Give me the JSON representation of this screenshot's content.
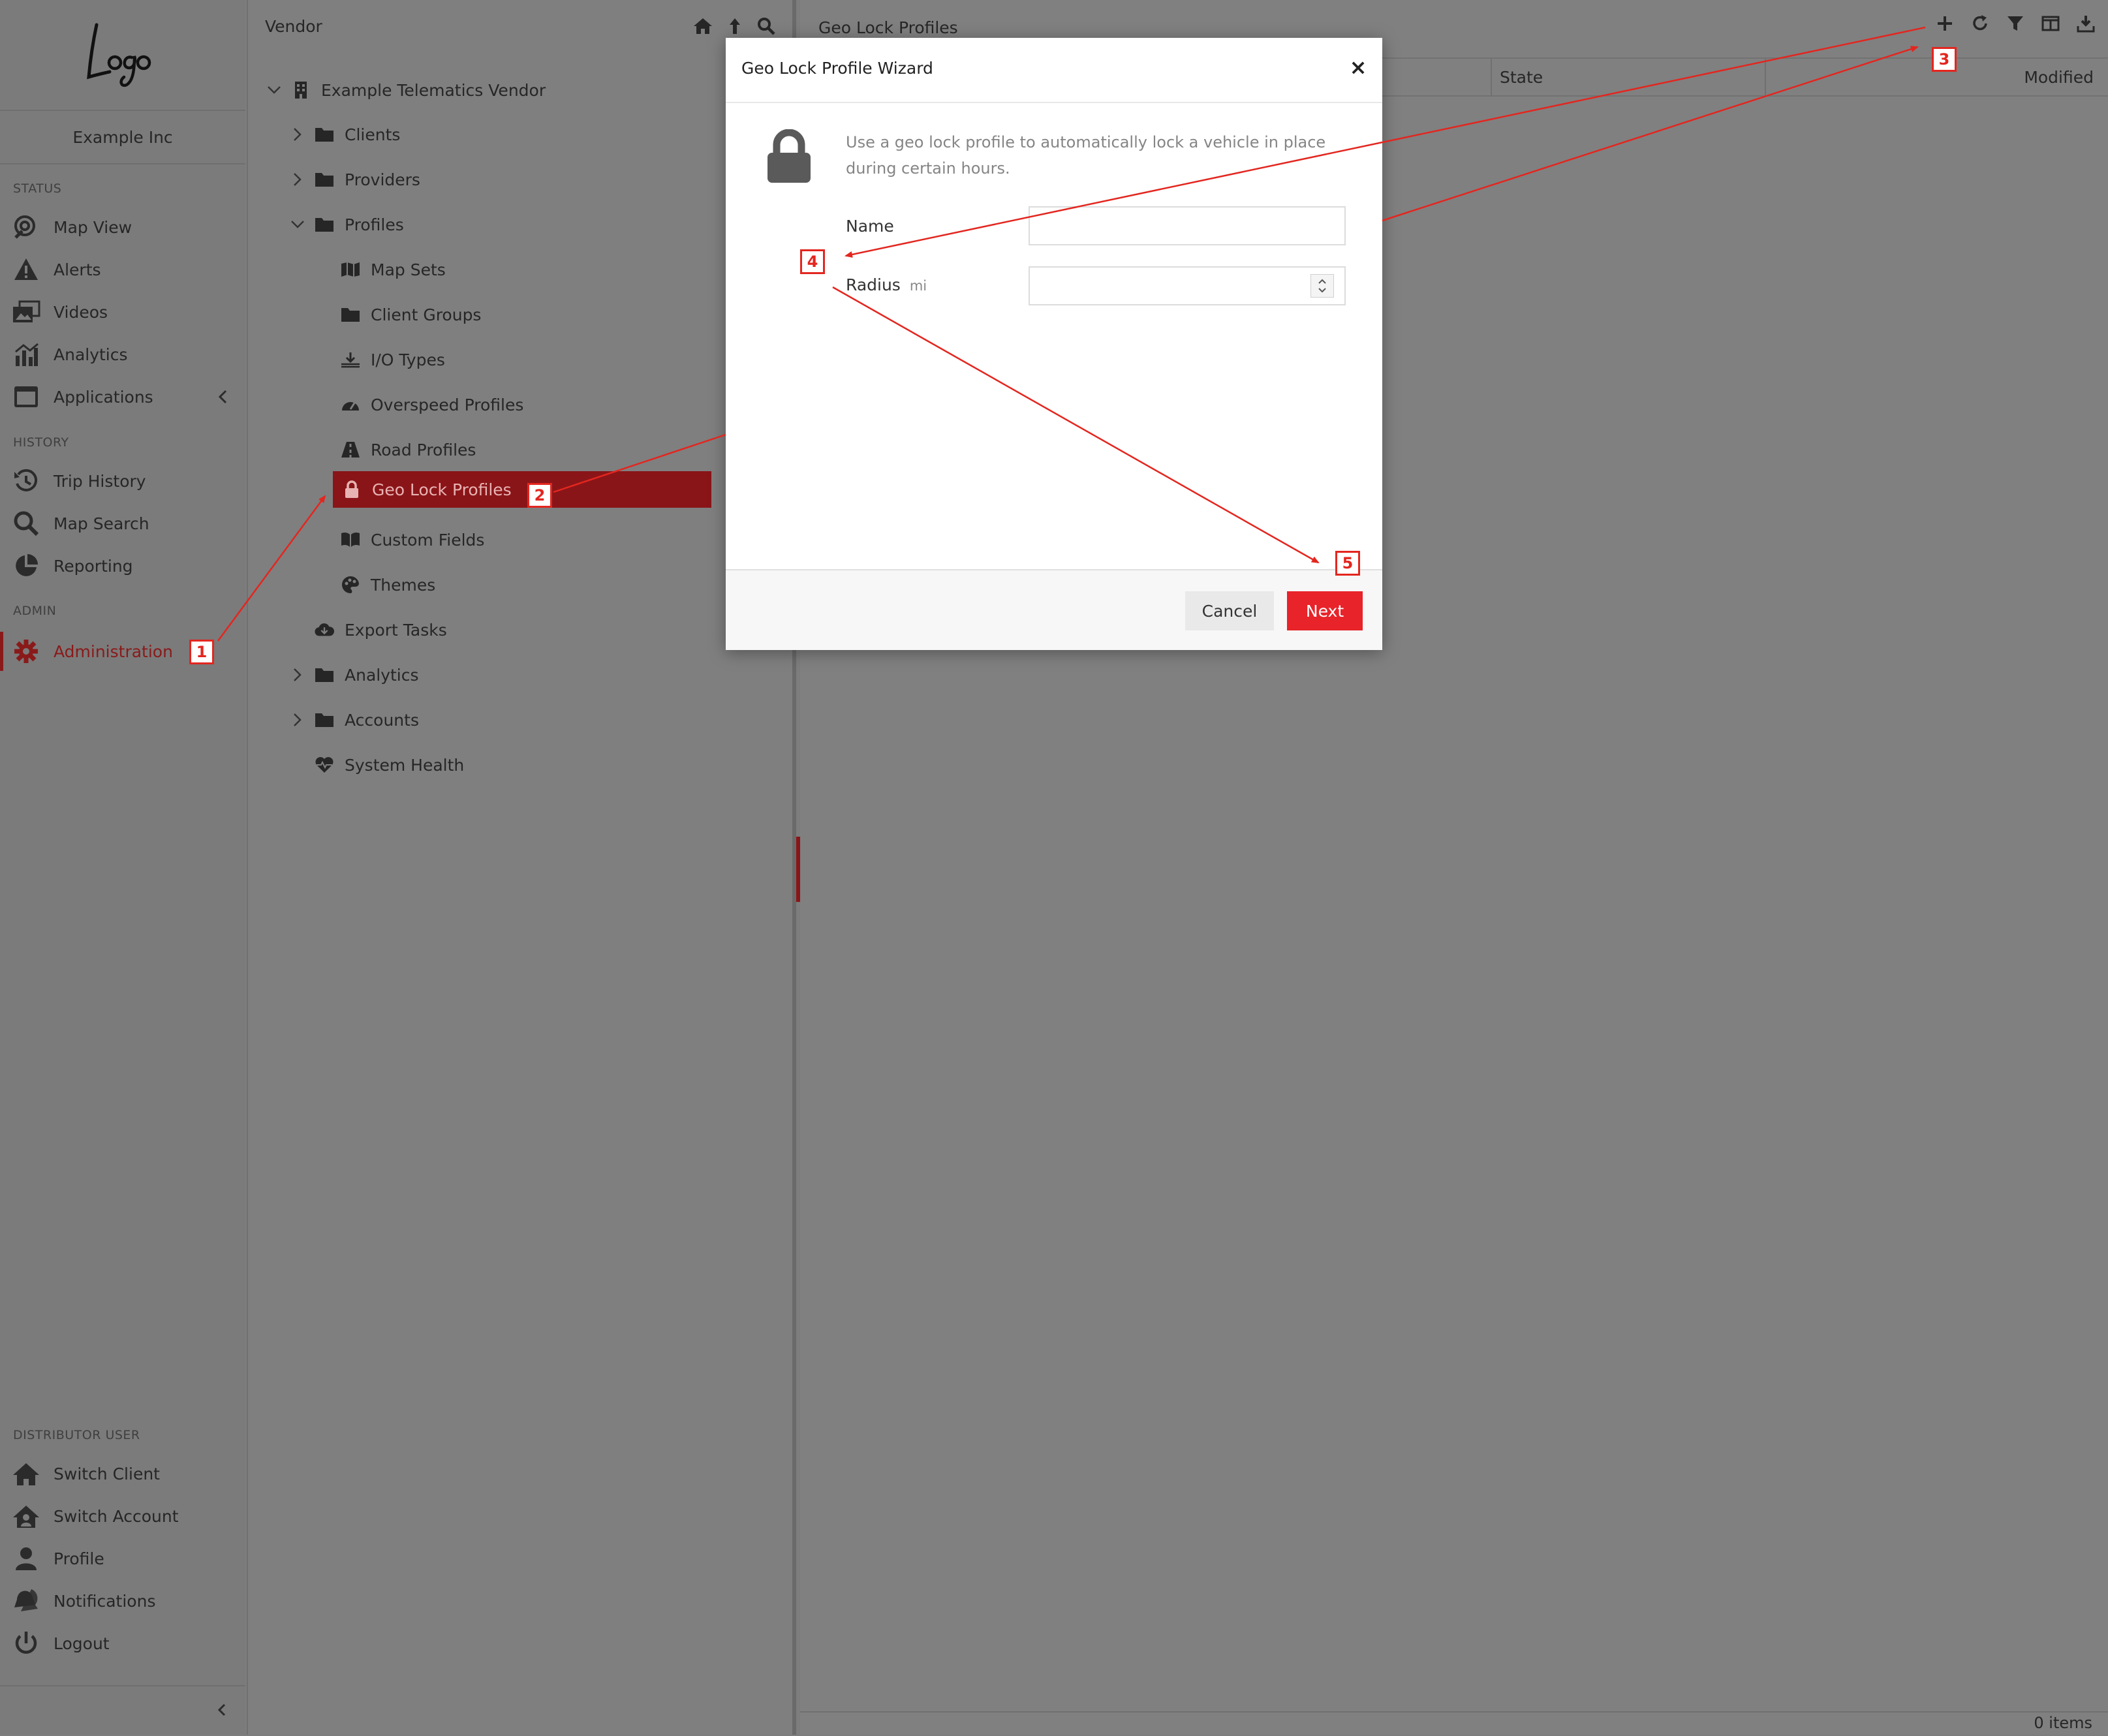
{
  "sidebar": {
    "org_name": "Example Inc",
    "sections": {
      "status": "STATUS",
      "history": "HISTORY",
      "admin": "ADMIN",
      "distributor": "DISTRIBUTOR USER"
    },
    "items": [
      {
        "label": "Map View",
        "icon": "map-view-icon"
      },
      {
        "label": "Alerts",
        "icon": "alert-icon"
      },
      {
        "label": "Videos",
        "icon": "video-icon"
      },
      {
        "label": "Analytics",
        "icon": "analytics-icon"
      },
      {
        "label": "Applications",
        "icon": "applications-icon"
      },
      {
        "label": "Trip History",
        "icon": "history-icon"
      },
      {
        "label": "Map Search",
        "icon": "search-icon"
      },
      {
        "label": "Reporting",
        "icon": "pie-chart-icon"
      },
      {
        "label": "Administration",
        "icon": "gear-icon",
        "active": true
      },
      {
        "label": "Switch Client",
        "icon": "home-icon"
      },
      {
        "label": "Switch Account",
        "icon": "home-user-icon"
      },
      {
        "label": "Profile",
        "icon": "user-icon"
      },
      {
        "label": "Notifications",
        "icon": "bell-icon"
      },
      {
        "label": "Logout",
        "icon": "power-icon"
      }
    ]
  },
  "tree": {
    "title": "Vendor",
    "root": "Example Telematics Vendor",
    "nodes": [
      {
        "label": "Clients",
        "icon": "folder-icon"
      },
      {
        "label": "Providers",
        "icon": "folder-icon"
      },
      {
        "label": "Profiles",
        "icon": "folder-icon"
      },
      {
        "label": "Map Sets",
        "icon": "map-icon"
      },
      {
        "label": "Client Groups",
        "icon": "folder-icon"
      },
      {
        "label": "I/O Types",
        "icon": "io-icon"
      },
      {
        "label": "Overspeed Profiles",
        "icon": "gauge-icon"
      },
      {
        "label": "Road Profiles",
        "icon": "road-icon"
      },
      {
        "label": "Geo Lock Profiles",
        "icon": "lock-icon",
        "selected": true
      },
      {
        "label": "Custom Fields",
        "icon": "book-icon"
      },
      {
        "label": "Themes",
        "icon": "palette-icon"
      },
      {
        "label": "Export Tasks",
        "icon": "cloud-download-icon"
      },
      {
        "label": "Analytics",
        "icon": "folder-icon"
      },
      {
        "label": "Accounts",
        "icon": "folder-icon"
      },
      {
        "label": "System Health",
        "icon": "heartbeat-icon"
      }
    ]
  },
  "grid": {
    "title": "Geo Lock Profiles",
    "columns": [
      "State",
      "Modified"
    ],
    "footer": "0 items"
  },
  "modal": {
    "title": "Geo Lock Profile Wizard",
    "description": "Use a geo lock profile to automatically lock a vehicle in place during certain hours.",
    "fields": {
      "name_label": "Name",
      "name_value": "",
      "radius_label": "Radius",
      "radius_unit": "mi",
      "radius_value": ""
    },
    "buttons": {
      "cancel": "Cancel",
      "next": "Next"
    }
  },
  "callouts": [
    "1",
    "2",
    "3",
    "4",
    "5"
  ],
  "colors": {
    "accent": "#e8232a",
    "selected": "#8a1518",
    "callout": "#e3261f"
  }
}
